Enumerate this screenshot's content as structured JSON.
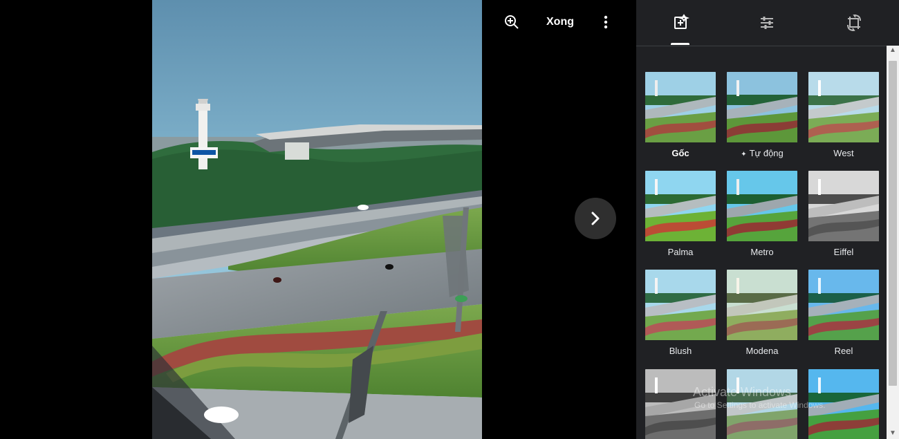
{
  "viewer": {
    "done_label": "Xong",
    "zoom_icon": "zoom-in-icon",
    "more_icon": "more-vert-icon",
    "next_icon": "chevron-right-icon"
  },
  "editor": {
    "tabs": [
      {
        "name": "filters",
        "icon": "auto-fix-icon",
        "selected": true
      },
      {
        "name": "adjust",
        "icon": "tune-icon",
        "selected": false
      },
      {
        "name": "crop",
        "icon": "crop-rotate-icon",
        "selected": false
      }
    ],
    "filters": [
      {
        "label": "Gốc",
        "selected": true
      },
      {
        "label": "Tự động",
        "icon": "sparkle-icon"
      },
      {
        "label": "West"
      },
      {
        "label": "Palma"
      },
      {
        "label": "Metro"
      },
      {
        "label": "Eiffel"
      },
      {
        "label": "Blush"
      },
      {
        "label": "Modena"
      },
      {
        "label": "Reel"
      },
      {
        "label": ""
      },
      {
        "label": ""
      },
      {
        "label": ""
      }
    ]
  },
  "watermark": {
    "title": "Activate Windows",
    "subtitle": "Go to Settings to activate Windows."
  },
  "colors": {
    "panel_background": "#202124",
    "viewer_background": "#000000",
    "text": "#ffffff",
    "scroll_track": "#f1f1f1"
  }
}
